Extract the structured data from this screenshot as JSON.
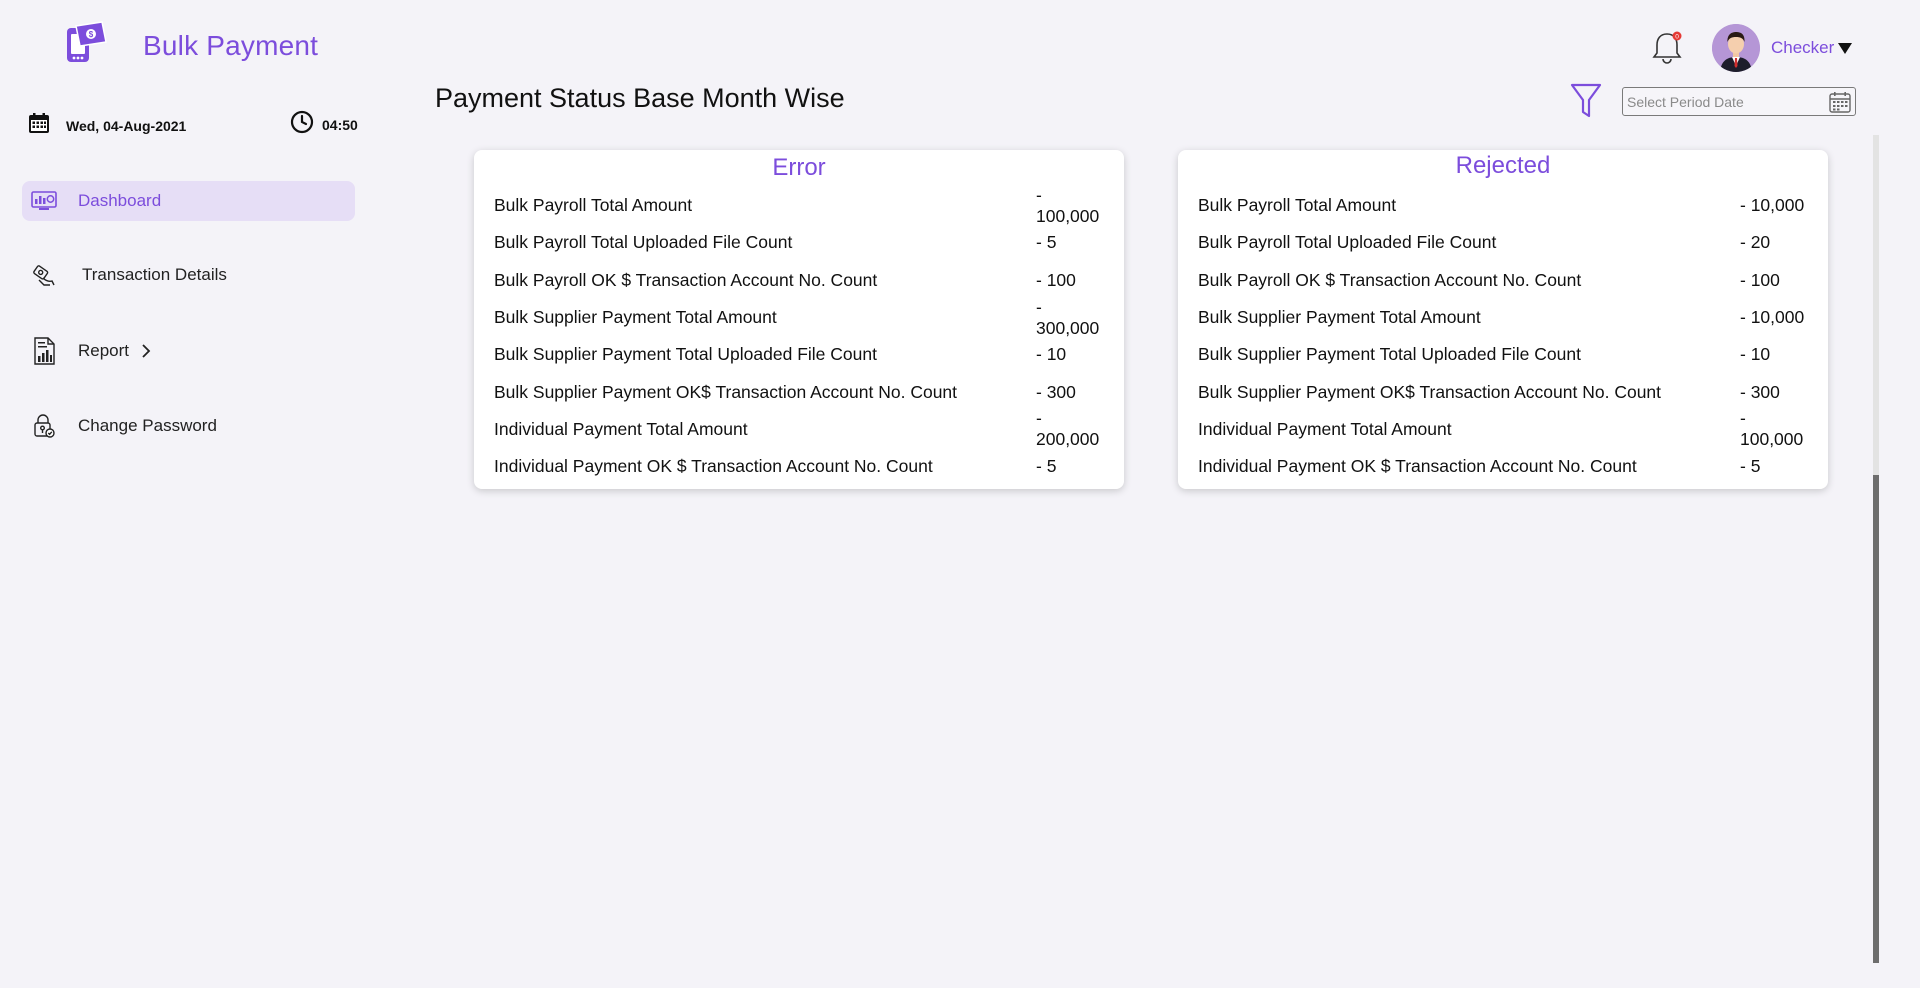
{
  "app": {
    "title": "Bulk Payment"
  },
  "sidebar": {
    "date": "Wed, 04-Aug-2021",
    "time": "04:50",
    "items": [
      {
        "label": "Dashboard",
        "icon": "dashboard-icon",
        "active": true
      },
      {
        "label": "Transaction Details",
        "icon": "transaction-icon",
        "active": false
      },
      {
        "label": "Report",
        "icon": "report-icon",
        "active": false
      },
      {
        "label": "Change Password",
        "icon": "password-lock-icon",
        "active": false
      }
    ]
  },
  "header": {
    "user": "Checker",
    "notification_badge": "0"
  },
  "main": {
    "page_title": "Payment Status Base Month Wise",
    "period_placeholder": "Select Period Date"
  },
  "cards": [
    {
      "title": "Error",
      "rows": [
        {
          "label": "Bulk Payroll Total Amount",
          "value": "- 100,000"
        },
        {
          "label": "Bulk Payroll Total Uploaded File Count",
          "value": "- 5"
        },
        {
          "label": "Bulk Payroll OK $ Transaction Account No. Count",
          "value": "- 100"
        },
        {
          "label": "Bulk Supplier Payment Total Amount",
          "value": "- 300,000"
        },
        {
          "label": "Bulk Supplier Payment Total Uploaded File Count",
          "value": "- 10"
        },
        {
          "label": "Bulk Supplier Payment OK$ Transaction Account No. Count",
          "value": "- 300"
        },
        {
          "label": "Individual Payment Total Amount",
          "value": "- 200,000"
        },
        {
          "label": "Individual Payment OK $ Transaction Account No. Count",
          "value": "- 5"
        }
      ]
    },
    {
      "title": "Rejected",
      "rows": [
        {
          "label": "Bulk Payroll Total Amount",
          "value": "- 10,000"
        },
        {
          "label": "Bulk Payroll Total Uploaded File Count",
          "value": "- 20"
        },
        {
          "label": "Bulk Payroll OK $ Transaction Account No. Count",
          "value": "- 100"
        },
        {
          "label": "Bulk Supplier Payment Total Amount",
          "value": "- 10,000"
        },
        {
          "label": "Bulk Supplier Payment Total Uploaded File Count",
          "value": "- 10"
        },
        {
          "label": "Bulk Supplier Payment OK$ Transaction Account No. Count",
          "value": "- 300"
        },
        {
          "label": "Individual Payment Total Amount",
          "value": "- 100,000"
        },
        {
          "label": "Individual Payment OK $ Transaction Account No. Count",
          "value": "- 5"
        }
      ]
    }
  ],
  "colors": {
    "accent": "#7c4ddc",
    "active_bg": "#e6def6",
    "page_bg": "#f4f3f8"
  }
}
